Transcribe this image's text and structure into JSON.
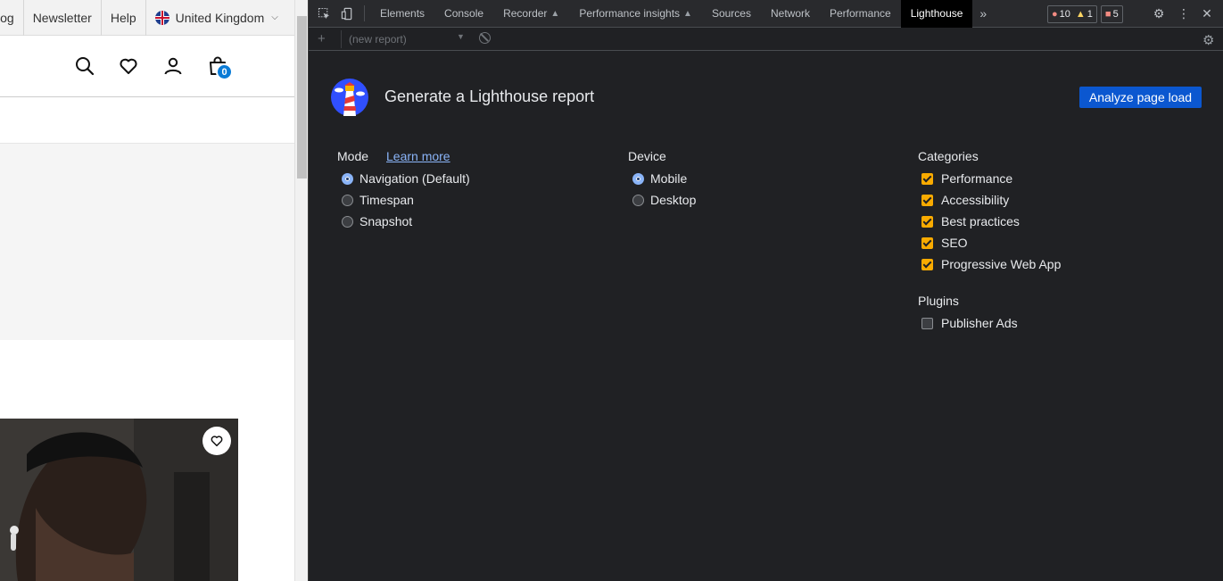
{
  "site": {
    "topbar": {
      "blog_partial": "log",
      "newsletter": "Newsletter",
      "help": "Help",
      "country": "United Kingdom"
    },
    "header": {
      "cart_count": "0",
      "icons": [
        "search-icon",
        "heart-icon",
        "user-icon",
        "bag-icon"
      ]
    }
  },
  "devtools": {
    "tabs": [
      {
        "label": "Elements"
      },
      {
        "label": "Console"
      },
      {
        "label": "Recorder"
      },
      {
        "label": "Performance insights"
      },
      {
        "label": "Sources"
      },
      {
        "label": "Network"
      },
      {
        "label": "Performance"
      },
      {
        "label": "Lighthouse"
      }
    ],
    "active_tab": "Lighthouse",
    "badges": {
      "errors": "10",
      "warnings": "1",
      "issues": "5"
    },
    "toolbar": {
      "report_select": "(new report)"
    },
    "lighthouse": {
      "title": "Generate a Lighthouse report",
      "analyze_button": "Analyze page load",
      "mode_label": "Mode",
      "learn_more": "Learn more",
      "modes": [
        {
          "label": "Navigation (Default)",
          "selected": true
        },
        {
          "label": "Timespan",
          "selected": false
        },
        {
          "label": "Snapshot",
          "selected": false
        }
      ],
      "device_label": "Device",
      "devices": [
        {
          "label": "Mobile",
          "selected": true
        },
        {
          "label": "Desktop",
          "selected": false
        }
      ],
      "categories_label": "Categories",
      "categories": [
        {
          "label": "Performance",
          "checked": true
        },
        {
          "label": "Accessibility",
          "checked": true
        },
        {
          "label": "Best practices",
          "checked": true
        },
        {
          "label": "SEO",
          "checked": true
        },
        {
          "label": "Progressive Web App",
          "checked": true
        }
      ],
      "plugins_label": "Plugins",
      "plugins": [
        {
          "label": "Publisher Ads",
          "checked": false
        }
      ]
    }
  },
  "colors": {
    "devtools_bg": "#202124",
    "accent_blue": "#0b57d0",
    "checkbox_orange": "#f9ab00",
    "link_blue": "#8ab4f8",
    "cart_badge": "#0a7bd6"
  }
}
